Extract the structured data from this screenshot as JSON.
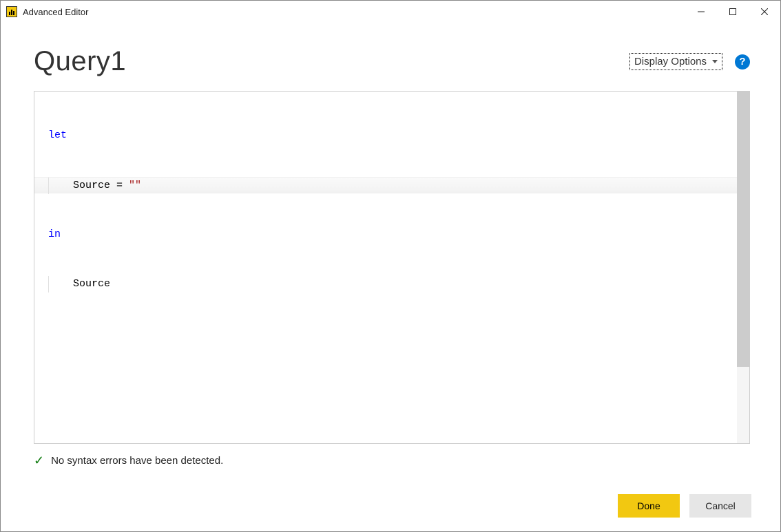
{
  "window": {
    "title": "Advanced Editor"
  },
  "header": {
    "page_title": "Query1",
    "display_options_label": "Display Options",
    "help_glyph": "?"
  },
  "code": {
    "tokens": {
      "let": "let",
      "source_assign_prefix": "Source = ",
      "empty_string": "\"\"",
      "in": "in",
      "source_ref": "Source"
    }
  },
  "status": {
    "check_glyph": "✓",
    "message": "No syntax errors have been detected."
  },
  "buttons": {
    "done": "Done",
    "cancel": "Cancel"
  }
}
